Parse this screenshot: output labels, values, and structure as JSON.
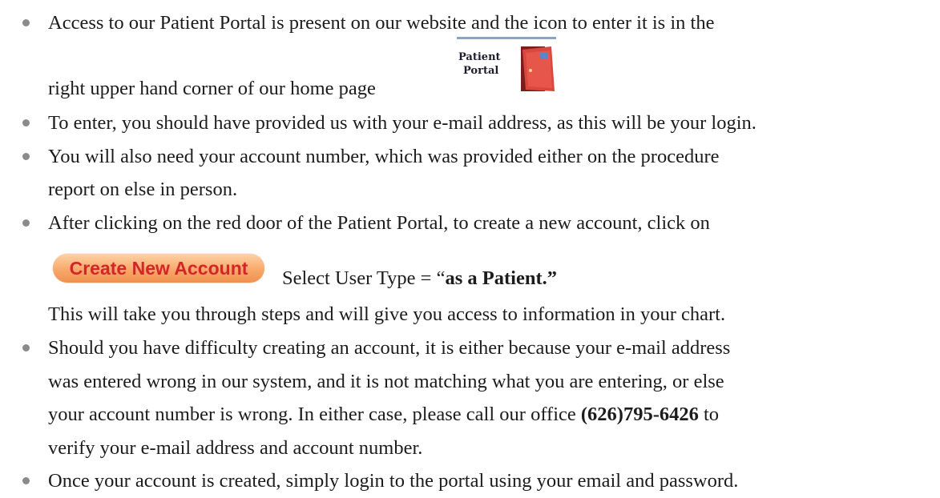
{
  "document": {
    "bullets": [
      {
        "lines": [
          "Access to our Patient Portal is present on our website and the icon to enter it is in the",
          "right upper hand corner of our home page"
        ]
      },
      {
        "lines": [
          "To enter, you should have provided us with your e-mail address, as this will be your login."
        ]
      },
      {
        "lines": [
          "You will also need your account number, which was provided either on the procedure",
          "report on else in person."
        ]
      },
      {
        "lines": [
          "After clicking on the red door of the Patient Portal, to create a new account, click on"
        ],
        "select_prefix": "Select User Type = “",
        "select_bold": "as a Patient",
        "select_suffix": ".”",
        "continuation": "This will take you through steps and will give you access to information in your chart."
      },
      {
        "lines": [
          "Should you  have difficulty creating an account, it is either because your e-mail address",
          "was entered wrong in our system, and it is not matching what you are entering, or else"
        ],
        "line3_prefix": "your account number is wrong. In either case, please call our office ",
        "phone": "(626)795-6426",
        "line3_suffix": " to",
        "line4": "verify your e-mail address and account number."
      },
      {
        "lines": [
          "Once your account is created, simply login to the portal using your email and password."
        ]
      }
    ],
    "portal_icon": {
      "label_line1": "Patient",
      "label_line2": "Portal",
      "icon_name": "patient-portal-door-icon",
      "door_color": "#d9473f"
    },
    "create_button": {
      "label": "Create New Account",
      "text_color": "#d2262a",
      "bg_color": "#f8a86a"
    }
  }
}
